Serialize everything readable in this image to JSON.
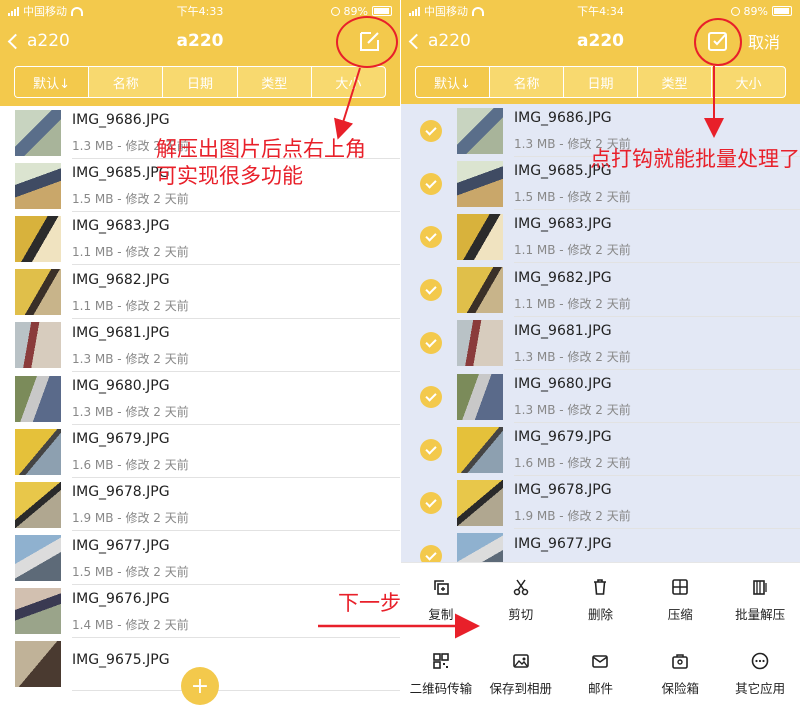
{
  "status": {
    "carrier": "中国移动",
    "battery": "89%",
    "time_left": "下午4:33",
    "time_right": "下午4:34"
  },
  "left_nav": {
    "back_label": "a220",
    "title": "a220"
  },
  "right_nav": {
    "back_label": "a220",
    "title": "a220",
    "cancel_label": "取消"
  },
  "sort_tabs": [
    "默认↓",
    "名称",
    "日期",
    "类型",
    "大小"
  ],
  "files": [
    {
      "name": "IMG_9686.JPG",
      "sub": "1.3 MB - 修改 2 天前"
    },
    {
      "name": "IMG_9685.JPG",
      "sub": "1.5 MB - 修改 2 天前"
    },
    {
      "name": "IMG_9683.JPG",
      "sub": "1.1 MB - 修改 2 天前"
    },
    {
      "name": "IMG_9682.JPG",
      "sub": "1.1 MB - 修改 2 天前"
    },
    {
      "name": "IMG_9681.JPG",
      "sub": "1.3 MB - 修改 2 天前"
    },
    {
      "name": "IMG_9680.JPG",
      "sub": "1.3 MB - 修改 2 天前"
    },
    {
      "name": "IMG_9679.JPG",
      "sub": "1.6 MB - 修改 2 天前"
    },
    {
      "name": "IMG_9678.JPG",
      "sub": "1.9 MB - 修改 2 天前"
    },
    {
      "name": "IMG_9677.JPG",
      "sub": "1.5 MB - 修改 2 天前"
    },
    {
      "name": "IMG_9676.JPG",
      "sub": "1.4 MB - 修改 2 天前"
    },
    {
      "name": "IMG_9675.JPG",
      "sub": ""
    }
  ],
  "toolbar": {
    "row1": [
      {
        "label": "复制",
        "icon": "copy-icon"
      },
      {
        "label": "剪切",
        "icon": "scissors-icon"
      },
      {
        "label": "删除",
        "icon": "trash-icon"
      },
      {
        "label": "压缩",
        "icon": "compress-icon"
      },
      {
        "label": "批量解压",
        "icon": "extract-icon"
      }
    ],
    "row2": [
      {
        "label": "二维码传输",
        "icon": "qr-code-icon"
      },
      {
        "label": "保存到相册",
        "icon": "photo-icon"
      },
      {
        "label": "邮件",
        "icon": "mail-icon"
      },
      {
        "label": "保险箱",
        "icon": "safe-icon"
      },
      {
        "label": "其它应用",
        "icon": "more-icon"
      }
    ]
  },
  "annotations": {
    "left_line1": "解压出图片后点右上角",
    "left_line2": "可实现很多功能",
    "right": "点打钩就能批量处理了",
    "next_step": "下一步"
  },
  "colors": {
    "accent": "#f3c94c",
    "annotation": "#e8202a",
    "selected_row": "#e3e8f5"
  }
}
